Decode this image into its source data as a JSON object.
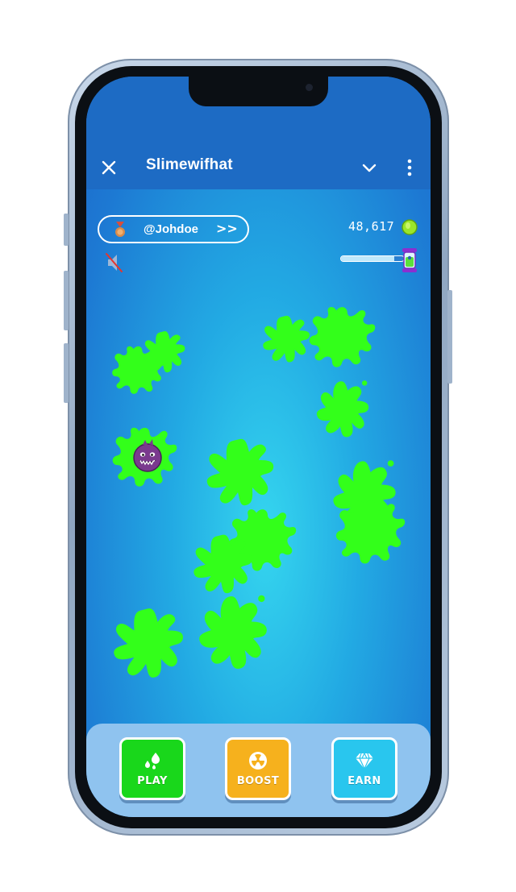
{
  "header": {
    "title": "Slimewifhat"
  },
  "profile": {
    "username": "@Johdoe",
    "arrow": ">>"
  },
  "stats": {
    "coins": "48,617",
    "slime_progress": 0.85
  },
  "nav": {
    "play_label": "PLAY",
    "boost_label": "BOOST",
    "earn_label": "EARN"
  },
  "colors": {
    "splat": "#33ff1a",
    "play": "#19d71b",
    "boost": "#f6b11d",
    "earn": "#29c6ee",
    "coin": "#9be62a"
  },
  "icons": [
    "close-icon",
    "chevron-down-icon",
    "more-icon",
    "medal-icon",
    "coin-icon",
    "slime-jar-icon",
    "mute-icon",
    "water-drops-icon",
    "radiation-icon",
    "diamond-icon",
    "monster-icon"
  ]
}
